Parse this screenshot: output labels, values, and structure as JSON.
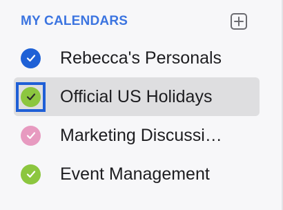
{
  "header": {
    "title": "MY CALENDARS",
    "add_icon": "plus-square-icon",
    "accent_color": "#3b74e0"
  },
  "calendars": [
    {
      "label": "Rebecca's Personals",
      "color": "#1f61d6",
      "checked": true,
      "selected": false
    },
    {
      "label": "Official US Holidays",
      "color": "#8cc63f",
      "checked": true,
      "selected": true
    },
    {
      "label": "Marketing Discussi…",
      "color": "#e79ac0",
      "checked": true,
      "selected": false
    },
    {
      "label": "Event Management",
      "color": "#8cc63f",
      "checked": true,
      "selected": false
    }
  ]
}
